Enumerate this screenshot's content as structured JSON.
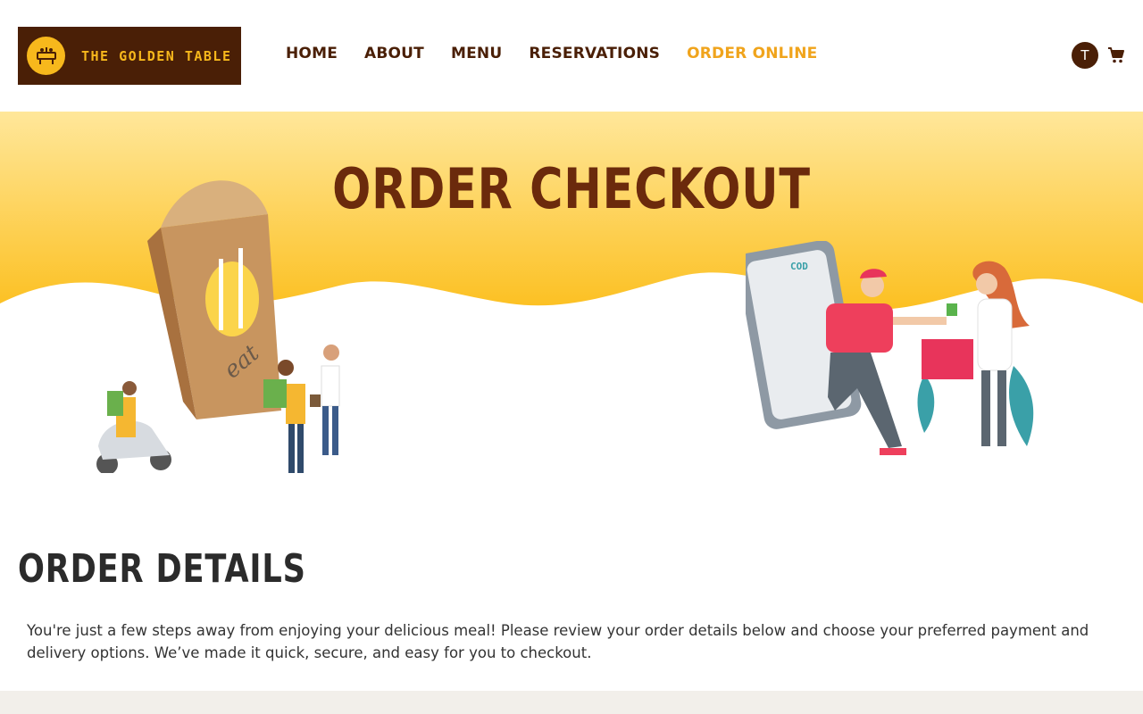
{
  "brand": {
    "name": "THE GOLDEN TABLE",
    "logo_icon": "dining-table-icon",
    "colors": {
      "primary": "#4a1f06",
      "accent": "#f7b81c",
      "active_nav": "#f0a41c",
      "hero_title": "#6b2a0c"
    }
  },
  "nav": {
    "items": [
      {
        "label": "HOME"
      },
      {
        "label": "ABOUT"
      },
      {
        "label": "MENU"
      },
      {
        "label": "RESERVATIONS"
      },
      {
        "label": "ORDER ONLINE",
        "active": true
      }
    ]
  },
  "user": {
    "initial": "T",
    "cart_icon": "cart-icon"
  },
  "hero": {
    "title": "ORDER CHECKOUT",
    "bag_label": "eat",
    "phone_label": "COD"
  },
  "details": {
    "title": "ORDER DETAILS",
    "text": "You're just a few steps away from enjoying your delicious meal! Please review your order details below and choose your preferred payment and delivery options. We’ve made it quick, secure, and easy for you to checkout."
  }
}
